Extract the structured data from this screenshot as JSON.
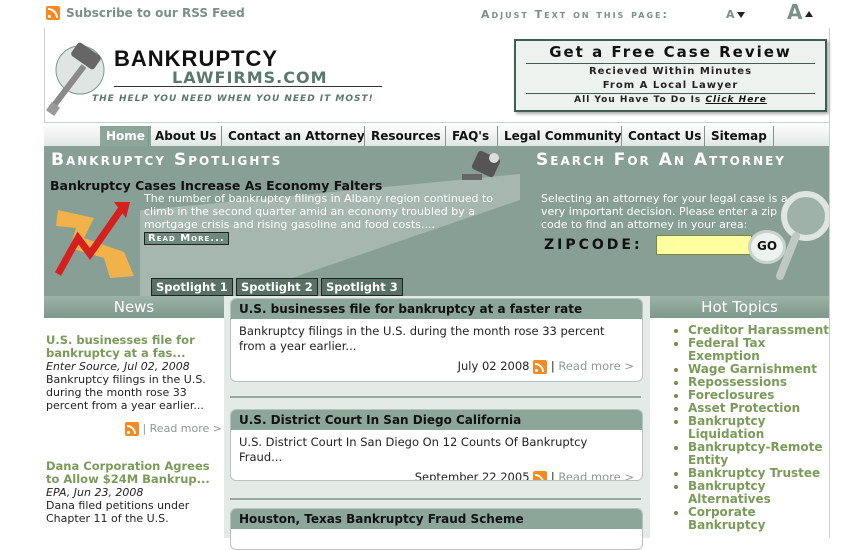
{
  "top": {
    "rss_label": "Subscribe to our RSS Feed",
    "adjust_label": "Adjust Text on this page:",
    "a_small": "A",
    "a_large": "A"
  },
  "header": {
    "logo_title": "BANKRUPTCY",
    "logo_sub": "LAWFIRMS.COM",
    "tagline": "THE HELP YOU NEED WHEN YOU NEED IT MOST!",
    "review_title": "Get a Free Case Review",
    "review_line1": "Recieved Within Minutes",
    "review_line2": "From A Local Lawyer",
    "review_line3_prefix": "All You Have To Do Is",
    "review_cta": "Click Here"
  },
  "nav": {
    "items": [
      "Home",
      "About Us",
      "Contact an Attorney",
      "Resources",
      "FAQ's",
      "Legal Community",
      "Contact Us",
      "Sitemap"
    ]
  },
  "spotlight": {
    "title": "Bankruptcy Spotlights",
    "headline": "Bankruptcy Cases Increase As Economy Falters",
    "body": "The number of bankruptcy filings in Albany region continued to climb in the second quarter amid an economy troubled by a mortgage crisis and rising gasoline and food costs....",
    "read_more": "Read More...",
    "tabs": [
      "Spotlight 1",
      "Spotlight 2",
      "Spotlight 3"
    ]
  },
  "search": {
    "title": "Search For An Attorney",
    "text": "Selecting an attorney for your legal case is a very important decision. Please enter a zip code to find an attorney in your area:",
    "zip_label": "ZIPCODE:",
    "zip_value": "",
    "go_label": "GO"
  },
  "news": {
    "heading": "News",
    "items": [
      {
        "title": "U.S. businesses file for bankruptcy at a fas...",
        "source": "Enter Source, Jul 02, 2008",
        "text": "Bankruptcy filings in the U.S. during the month rose 33 percent from a year earlier...",
        "more": "Read more >"
      },
      {
        "title": "Dana Corporation Agrees to Allow $24M Bankrup...",
        "source": "EPA, Jun 23, 2008",
        "text": "Dana filed petitions under Chapter 11 of the U.S.",
        "more": ""
      }
    ]
  },
  "articles": [
    {
      "title": "U.S. businesses file for bankruptcy at a faster rate",
      "body": "Bankruptcy filings in the U.S. during the month rose 33 percent from a year earlier...",
      "date": "July 02 2008",
      "more": "Read more >"
    },
    {
      "title": "U.S. District Court In San Diego California",
      "body": "U.S. District Court In San Diego On 12 Counts Of Bankruptcy Fraud...",
      "date": "September 22 2005",
      "more": "Read more >"
    },
    {
      "title": "Houston, Texas Bankruptcy Fraud Scheme",
      "body": "",
      "date": "",
      "more": ""
    }
  ],
  "hot_topics": {
    "heading": "Hot Topics",
    "items": [
      "Creditor Harassment",
      "Federal Tax Exemption",
      "Wage Garnishment",
      "Repossessions",
      "Foreclosures",
      "Asset Protection",
      "Bankruptcy Liquidation",
      "Bankruptcy-Remote Entity",
      "Bankruptcy Trustee",
      "Bankruptcy Alternatives",
      "Corporate Bankruptcy"
    ]
  },
  "colors": {
    "brand_green": "#879f94",
    "accent_link": "#7a9b59",
    "rss_orange": "#f78a1f"
  }
}
